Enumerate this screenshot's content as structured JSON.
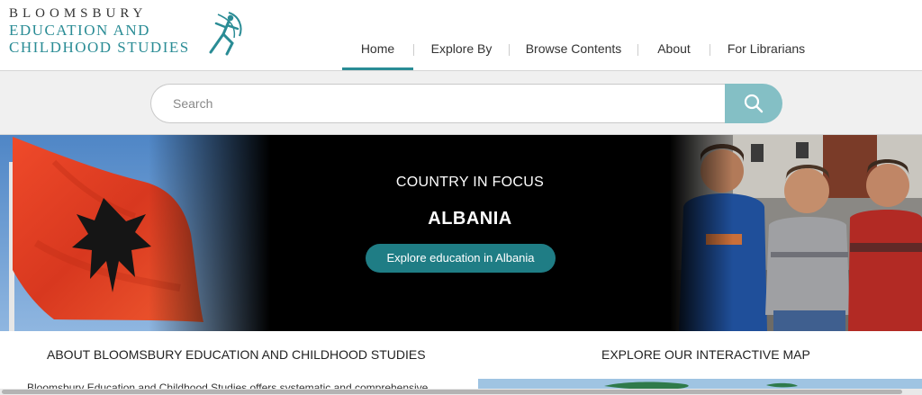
{
  "brand": {
    "line1": "BLOOMSBURY",
    "line2": "EDUCATION AND",
    "line3": "CHILDHOOD STUDIES",
    "icon": "archer-figure-logo",
    "color_teal": "#2a8c95",
    "color_dark": "#333333"
  },
  "nav": {
    "items": [
      {
        "label": "Home",
        "active": true
      },
      {
        "label": "Explore By"
      },
      {
        "label": "Browse Contents"
      },
      {
        "label": "About"
      },
      {
        "label": "For Librarians"
      }
    ]
  },
  "search": {
    "placeholder": "Search",
    "value": "",
    "button_icon": "search-icon",
    "button_color": "#84bfc5"
  },
  "hero": {
    "kicker": "COUNTRY IN FOCUS",
    "title": "ALBANIA",
    "button_label": "Explore education in Albania",
    "button_color": "#1f7d85",
    "left_image": "albanian-flag-photo",
    "right_image": "children-photo"
  },
  "about": {
    "title": "ABOUT BLOOMSBURY EDUCATION AND CHILDHOOD STUDIES",
    "body_partial": "Bloomsbury Education and Childhood Studies offers systematic and comprehensive"
  },
  "map_section": {
    "title": "EXPLORE OUR INTERACTIVE MAP"
  }
}
